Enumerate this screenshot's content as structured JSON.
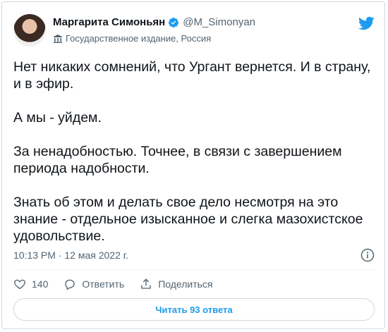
{
  "author": {
    "display_name": "Маргарита Симоньян",
    "handle": "@M_Simonyan",
    "label": "Государственное издание, Россия",
    "verified": true
  },
  "icons": {
    "verified": "verified-badge-icon",
    "gov_label": "government-building-icon",
    "brand": "twitter-bird-icon",
    "info": "info-icon",
    "like": "heart-icon",
    "reply": "speech-bubble-icon",
    "share": "share-icon"
  },
  "tweet": {
    "paragraphs": [
      "Нет никаких сомнений, что Ургант вернется. И в страну, и в эфир.",
      "А мы - уйдем.",
      "За ненадобностью. Точнее, в связи с завершением периода надобности.",
      "Знать об этом и делать свое дело несмотря на это знание - отдельное изысканное и слегка мазохистское удовольствие."
    ],
    "timestamp": "10:13 PM · 12 мая 2022 г."
  },
  "actions": {
    "like_count": "140",
    "reply_label": "Ответить",
    "share_label": "Поделиться"
  },
  "read_replies_label": "Читать 93 ответа",
  "colors": {
    "accent": "#1d9bf0",
    "text": "#0f1419",
    "secondary": "#536471",
    "border": "#cfd9de"
  }
}
